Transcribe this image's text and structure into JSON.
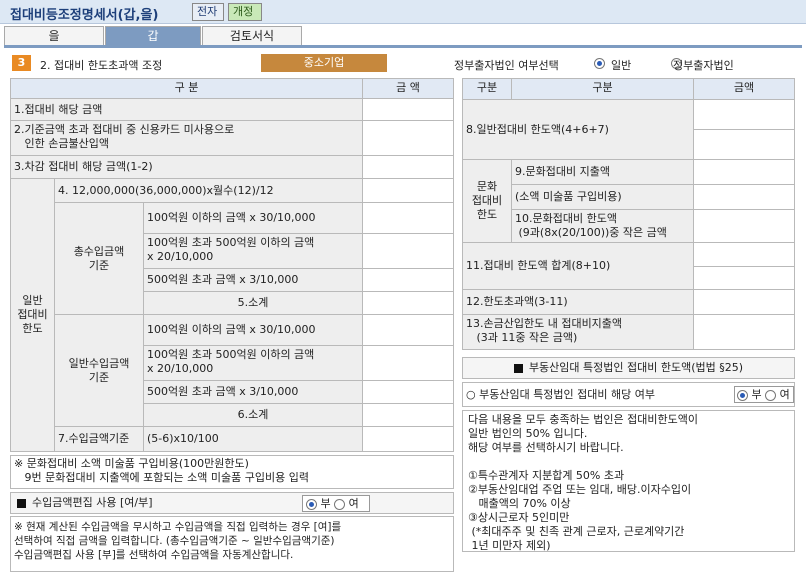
{
  "header": {
    "title": "접대비등조정명세서(갑,을)",
    "btn_e": "전자",
    "btn_o": "개정"
  },
  "tabs": [
    "을",
    "갑",
    "검토서식"
  ],
  "section": {
    "num": "3",
    "title": "2. 접대비 한도초과액 조정",
    "badge": "중소기업",
    "gov_label": "정부출자법인 여부선택",
    "opt1": "일반",
    "opt2": "정부출자법인"
  },
  "left": {
    "h_gubun": "구            분",
    "h_amount": "금    액",
    "r1": "1.접대비 해당 금액",
    "r2": "2.기준금액 초과 접대비 중 신용카드 미사용으로\n   인한 손금불산입액",
    "r3": "3.차감 접대비 해당 금액(1-2)",
    "r4": "4. 12,000,000(36,000,000)x월수(12)/12",
    "general_limit": "일반\n접대비\n한도",
    "total_income": "총수입금액\n기준",
    "general_income": "일반수입금액\n기준",
    "t_rows": [
      "100억원 이하의 금액 x 30/10,000",
      "100억원 초과 500억원 이하의 금액\nx 20/10,000",
      "500억원 초과 금액 x 3/10,000"
    ],
    "subtotal5": "5.소계",
    "g_rows": [
      "100억원 이하의 금액 x 30/10,000",
      "100억원 초과 500억원 이하의 금액\nx 20/10,000",
      "500억원 초과 금액 x 3/10,000"
    ],
    "subtotal6": "6.소계",
    "r7a": "7.수입금액기준",
    "r7b": "(5-6)x10/100",
    "note": "※ 문화접대비 소액 미술품 구입비용(100만원한도)\n   9번 문화접대비 지출액에 포함되는 소액 미술품 구입비용 입력",
    "edit_title": "수입금액편집 사용 [여/부]",
    "edit_yes": "부",
    "edit_no": "여",
    "edit_note": "※ 현재 계산된 수입금액을 무시하고 수입금액을 직접 입력하는 경우 [여]를\n선택하여 직접 금액을 입력합니다. (총수입금액기준 ~ 일반수입금액기준)\n수입금액편집 사용 [부]를 선택하여 수입금액을 자동계산합니다."
  },
  "right": {
    "h_gubun1": "구분",
    "h_gubun2": "구분",
    "h_amount": "금액",
    "r8": "8.일반접대비 한도액(4+6+7)",
    "culture": "문화\n접대비\n한도",
    "r9": "9.문화접대비 지출액",
    "r9b": "(소액 미술품 구입비용)",
    "r10": "10.문화접대비 한도액\n (9과(8x(20/100))중 작은 금액",
    "r11": "11.접대비 한도액 합계(8+10)",
    "r12": "12.한도초과액(3-11)",
    "r13": "13.손금산입한도 내 접대비지출액\n   (3과 11중 작은 금액)",
    "re_title": "부동산임대 특정법인 접대비 한도액(법법 §25)",
    "re_q": "○ 부동산임대 특정법인 접대비 해당 여부",
    "re_yes": "부",
    "re_no": "여",
    "re_note": "다음 내용을 모두 충족하는 법인은 접대비한도액이\n일반 법인의 50% 입니다.\n해당 여부를 선택하시기 바랍니다.\n\n①특수관계자 지분합계 50% 초과\n②부동산임대업 주업 또는 임대, 배당.이자수입이\n   매출액의 70% 이상\n③상시근로자 5인미만\n (*최대주주 및 친족 관계 근로자, 근로계약기간\n 1년 미만자 제외)"
  },
  "colors": {
    "accent": "#7d9bc1",
    "badge": "#c6883d",
    "sec_num": "#e98a23"
  }
}
